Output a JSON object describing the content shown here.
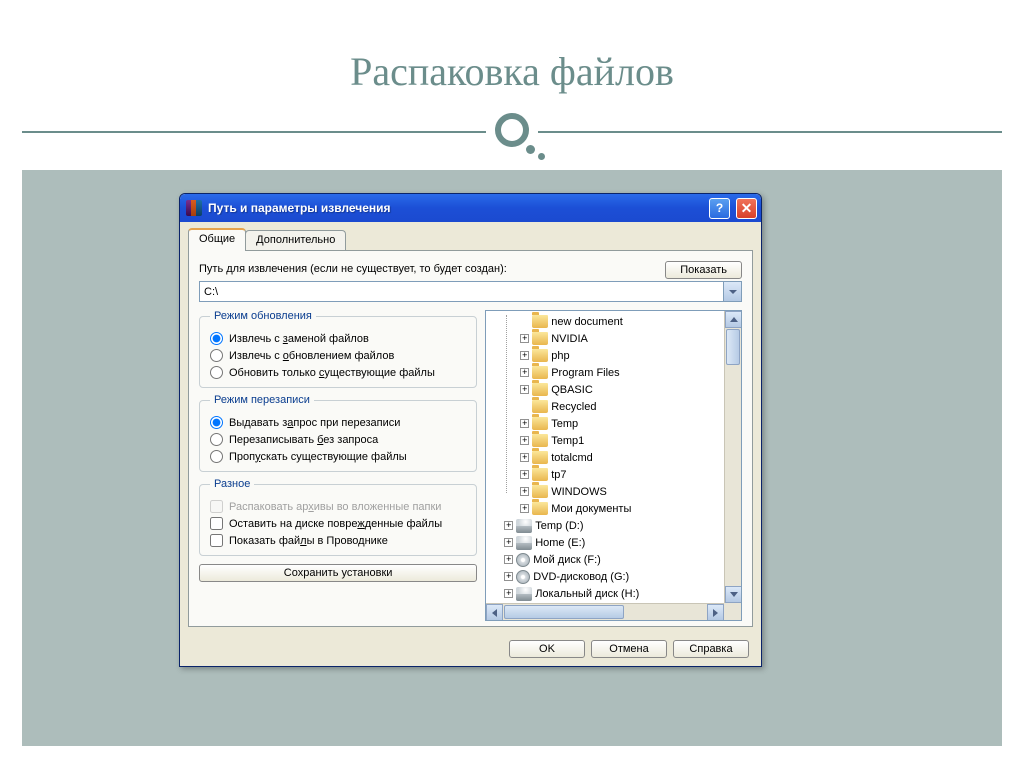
{
  "slide": {
    "title": "Распаковка файлов"
  },
  "window": {
    "title": "Путь и параметры извлечения"
  },
  "tabs": {
    "general": "Общие",
    "advanced": "Дополнительно"
  },
  "path": {
    "label": "Путь для извлечения (если не существует, то будет создан):",
    "value": "C:\\",
    "show_button": "Показать"
  },
  "groups": {
    "update": {
      "legend": "Режим обновления",
      "opt1_pre": "Извлечь с ",
      "opt1_u": "з",
      "opt1_post": "аменой файлов",
      "opt2_pre": "Извлечь с ",
      "opt2_u": "о",
      "opt2_post": "бновлением файлов",
      "opt3_pre": "Обновить только ",
      "opt3_u": "с",
      "opt3_post": "уществующие файлы",
      "selected": 0
    },
    "overwrite": {
      "legend": "Режим перезаписи",
      "opt1_pre": "Выдавать з",
      "opt1_u": "а",
      "opt1_post": "прос при перезаписи",
      "opt2_pre": "Перезаписывать ",
      "opt2_u": "б",
      "opt2_post": "ез запроса",
      "opt3_pre": "Проп",
      "opt3_u": "у",
      "opt3_post": "скать существующие файлы",
      "selected": 0
    },
    "misc": {
      "legend": "Разное",
      "chk1_pre": "Распаковать ар",
      "chk1_u": "х",
      "chk1_post": "ивы во вложенные папки",
      "chk2_pre": "Оставить на диске повре",
      "chk2_u": "ж",
      "chk2_post": "денные файлы",
      "chk3_pre": "Показать фай",
      "chk3_u": "л",
      "chk3_post": "ы в Проводнике"
    },
    "save_button": "Сохранить установки"
  },
  "tree": [
    {
      "type": "folder",
      "label": "new document",
      "expander": "none",
      "level": 1
    },
    {
      "type": "folder",
      "label": "NVIDIA",
      "expander": "plus",
      "level": 1
    },
    {
      "type": "folder",
      "label": "php",
      "expander": "plus",
      "level": 1
    },
    {
      "type": "folder",
      "label": "Program Files",
      "expander": "plus",
      "level": 1
    },
    {
      "type": "folder",
      "label": "QBASIC",
      "expander": "plus",
      "level": 1
    },
    {
      "type": "folder",
      "label": "Recycled",
      "expander": "none",
      "level": 1
    },
    {
      "type": "folder",
      "label": "Temp",
      "expander": "plus",
      "level": 1
    },
    {
      "type": "folder",
      "label": "Temp1",
      "expander": "plus",
      "level": 1
    },
    {
      "type": "folder",
      "label": "totalcmd",
      "expander": "plus",
      "level": 1
    },
    {
      "type": "folder",
      "label": "tp7",
      "expander": "plus",
      "level": 1
    },
    {
      "type": "folder",
      "label": "WINDOWS",
      "expander": "plus",
      "level": 1
    },
    {
      "type": "folder",
      "label": "Мои документы",
      "expander": "plus",
      "level": 1
    },
    {
      "type": "drive",
      "label": "Temp (D:)",
      "expander": "plus",
      "level": 0
    },
    {
      "type": "drive",
      "label": "Home (E:)",
      "expander": "plus",
      "level": 0
    },
    {
      "type": "cd",
      "label": "Мой диск (F:)",
      "expander": "plus",
      "level": 0
    },
    {
      "type": "cd",
      "label": "DVD-дисковод (G:)",
      "expander": "plus",
      "level": 0
    },
    {
      "type": "drive",
      "label": "Локальный диск (H:)",
      "expander": "plus",
      "level": 0
    }
  ],
  "dialog_buttons": {
    "ok": "OK",
    "cancel": "Отмена",
    "help": "Справка"
  }
}
